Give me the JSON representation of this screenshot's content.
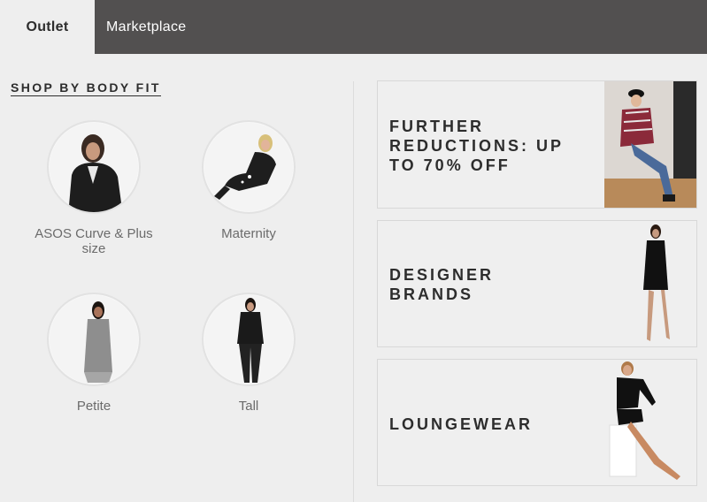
{
  "tabs": [
    {
      "label": "Outlet",
      "active": true
    },
    {
      "label": "Marketplace",
      "active": false
    }
  ],
  "body_fit": {
    "title": "SHOP BY BODY FIT",
    "items": [
      {
        "label": "ASOS Curve & Plus size",
        "icon": "plus-size-model-image"
      },
      {
        "label": "Maternity",
        "icon": "maternity-model-image"
      },
      {
        "label": "Petite",
        "icon": "petite-model-image"
      },
      {
        "label": "Tall",
        "icon": "tall-model-image"
      }
    ]
  },
  "promos": [
    {
      "text": "FURTHER\nREDUCTIONS: UP\nTO 70% OFF",
      "icon": "sale-model-photo"
    },
    {
      "text": "DESIGNER\nBRANDS",
      "icon": "designer-model-photo"
    },
    {
      "text": "LOUNGEWEAR",
      "icon": "loungewear-model-photo"
    }
  ],
  "colors": {
    "tabbar": "#525050",
    "page_bg": "#eeeeee",
    "text": "#2d2d2d",
    "muted_text": "#6b6b6b"
  }
}
